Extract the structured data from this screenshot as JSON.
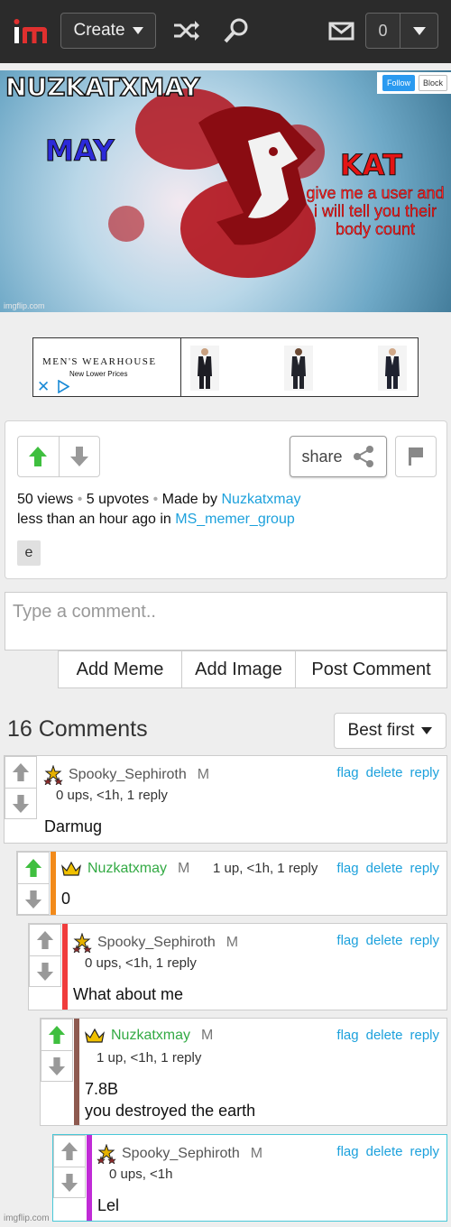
{
  "nav": {
    "create_label": "Create",
    "notif_count": "0"
  },
  "banner": {
    "title": "NUZKATXMAY",
    "left_text": "MAY",
    "right_text": "KAT",
    "body_text": "give me a user and i will tell you their body count",
    "follow_label": "Follow",
    "block_label": "Block",
    "watermark": "imgflip.com",
    "accent_red": "#b3121b"
  },
  "ad": {
    "brand": "MEN'S WEARHOUSE",
    "tagline": "New Lower Prices",
    "close_glyph": "✕"
  },
  "meme": {
    "views": "50 views",
    "upvotes": "5 upvotes",
    "made_by_prefix": "Made by",
    "author": "Nuzkatxmay",
    "time_prefix": "less than an hour ago in",
    "group": "MS_memer_group",
    "tag": "e",
    "share_label": "share"
  },
  "compose": {
    "placeholder": "Type a comment..",
    "add_meme": "Add Meme",
    "add_image": "Add Image",
    "post_comment": "Post Comment"
  },
  "comments_header": {
    "count_label": "16 Comments",
    "sort_label": "Best first"
  },
  "actions": {
    "flag": "flag",
    "delete": "delete",
    "reply": "reply"
  },
  "comments": [
    {
      "user": "Spooky_Sephiroth",
      "mod": "M",
      "stats": "0 ups, <1h, 1 reply",
      "text": "Darmug",
      "icon": "stars-icon",
      "bar_color": ""
    },
    {
      "user": "Nuzkatxmay",
      "mod": "M",
      "stats": "1 up, <1h, 1 reply",
      "text": "0",
      "icon": "crown-icon",
      "bar_color": "#f28a1a"
    },
    {
      "user": "Spooky_Sephiroth",
      "mod": "M",
      "stats": "0 ups, <1h, 1 reply",
      "text": "What about me",
      "icon": "stars-icon",
      "bar_color": "#f03c3c"
    },
    {
      "user": "Nuzkatxmay",
      "mod": "M",
      "stats": "1 up, <1h, 1 reply",
      "text_line1": "7.8B",
      "text_line2": "you destroyed the earth",
      "icon": "crown-icon",
      "bar_color": "#8e5a50"
    },
    {
      "user": "Spooky_Sephiroth",
      "mod": "M",
      "stats": "0 ups, <1h",
      "text": "Lel",
      "icon": "stars-icon",
      "bar_color": "#c02bd6"
    }
  ],
  "footer_watermark": "imgflip.com"
}
